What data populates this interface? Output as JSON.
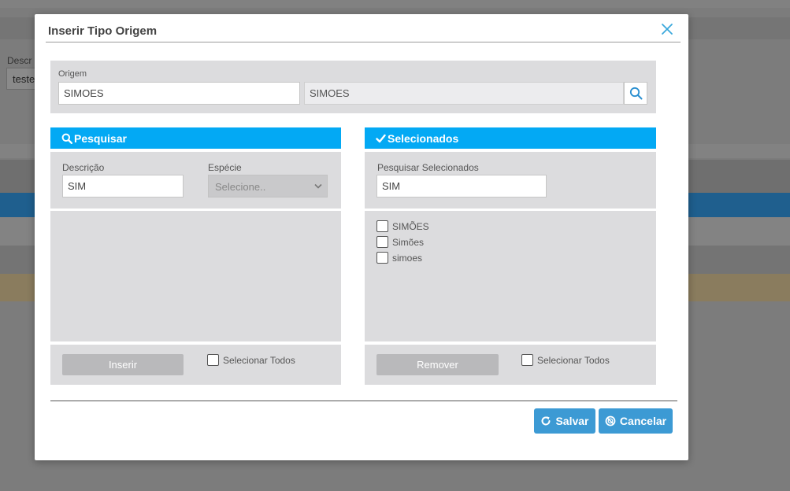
{
  "background": {
    "field_label": "Descr",
    "field_value": "teste"
  },
  "modal": {
    "title": "Inserir Tipo Origem",
    "close_icon": "close-icon"
  },
  "origem": {
    "label": "Origem",
    "input_value": "SIMOES",
    "display_value": "SIMOES",
    "search_icon": "search-icon"
  },
  "pesquisar": {
    "header": "Pesquisar",
    "icon": "search-icon",
    "descricao_label": "Descrição",
    "descricao_value": "SIM",
    "especie_label": "Espécie",
    "especie_selected": "Selecione..",
    "insert_label": "Inserir",
    "select_all_label": "Selecionar Todos"
  },
  "selecionados": {
    "header": "Selecionados",
    "icon": "check-icon",
    "search_label": "Pesquisar Selecionados",
    "search_value": "SIM",
    "items": [
      {
        "label": "SIMÕES",
        "checked": false
      },
      {
        "label": "Simões",
        "checked": false
      },
      {
        "label": "simoes",
        "checked": false
      }
    ],
    "remove_label": "Remover",
    "select_all_label": "Selecionar Todos"
  },
  "footer": {
    "save_label": "Salvar",
    "cancel_label": "Cancelar"
  },
  "colors": {
    "accent": "#03a9f4",
    "primary_button": "#3c9ad4",
    "panel_gray": "#dcdcde",
    "disabled_button": "#b9b9bb"
  }
}
